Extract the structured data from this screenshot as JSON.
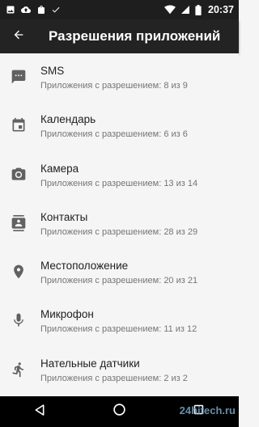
{
  "status_bar": {
    "time": "20:37",
    "icons_left": [
      "image-icon",
      "cloud-upload-icon",
      "shopping-bag-icon",
      "check-icon"
    ],
    "icons_right": [
      "wifi-icon",
      "signal-icon",
      "battery-icon"
    ]
  },
  "app_bar": {
    "title": "Разрешения приложений",
    "back_icon": "arrow-back-icon"
  },
  "permissions": [
    {
      "label": "SMS",
      "summary": "Приложения с разрешением: 8 из 9",
      "icon": "sms-icon"
    },
    {
      "label": "Календарь",
      "summary": "Приложения с разрешением: 6 из 6",
      "icon": "calendar-icon"
    },
    {
      "label": "Камера",
      "summary": "Приложения с разрешением: 13 из 14",
      "icon": "camera-icon"
    },
    {
      "label": "Контакты",
      "summary": "Приложения с разрешением: 28 из 29",
      "icon": "contacts-icon"
    },
    {
      "label": "Местоположение",
      "summary": "Приложения с разрешением: 20 из 21",
      "icon": "location-icon"
    },
    {
      "label": "Микрофон",
      "summary": "Приложения с разрешением: 11 из 12",
      "icon": "microphone-icon"
    },
    {
      "label": "Нательные датчики",
      "summary": "Приложения с разрешением: 2 из 2",
      "icon": "body-sensors-icon"
    }
  ],
  "nav_bar": {
    "buttons": [
      "back-triangle-icon",
      "home-circle-icon",
      "recents-square-icon"
    ]
  },
  "watermark": "24hitech.ru",
  "colors": {
    "status_bar_bg": "#1e1e1e",
    "app_bar_bg": "#232323",
    "list_bg": "#f5f5f5",
    "title_text": "#212121",
    "summary_text": "#757575",
    "icon": "#616161",
    "nav_bar_bg": "#000000"
  }
}
